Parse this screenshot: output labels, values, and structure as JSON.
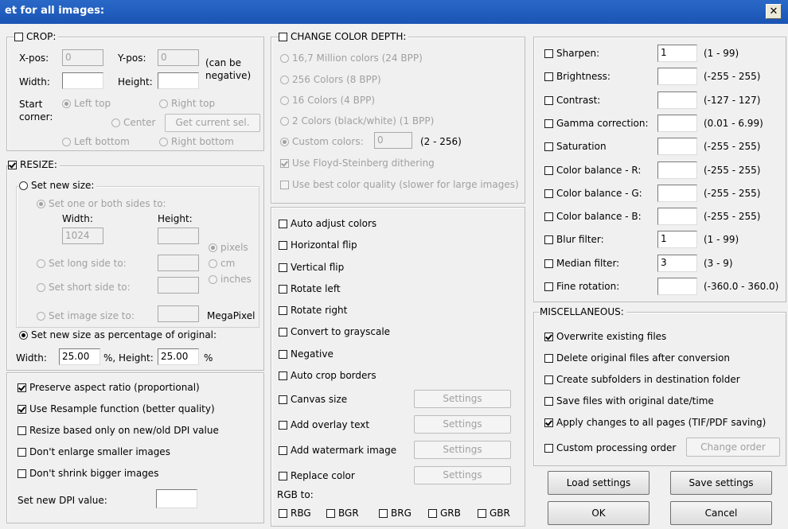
{
  "window": {
    "title": "et for all images:",
    "close_label": "✕"
  },
  "crop": {
    "legend": "CROP:",
    "xpos_label": "X-pos:",
    "xpos_value": "0",
    "ypos_label": "Y-pos:",
    "ypos_value": "0",
    "can_be_line1": "(can be",
    "can_be_line2": "negative)",
    "width_label": "Width:",
    "width_value": "",
    "height_label": "Height:",
    "height_value": "",
    "start_line1": "Start",
    "start_line2": "corner:",
    "left_top": "Left top",
    "right_top": "Right top",
    "center": "Center",
    "get_current_sel": "Get current sel.",
    "left_bottom": "Left bottom",
    "right_bottom": "Right bottom"
  },
  "resize": {
    "legend": "RESIZE:",
    "set_new_size": "Set new size:",
    "set_one_or_both": "Set one or both sides to:",
    "width_label": "Width:",
    "height_label": "Height:",
    "width_value": "1024",
    "height_value": "",
    "pixels": "pixels",
    "cm": "cm",
    "inches": "inches",
    "set_long_side": "Set long side to:",
    "long_side_value": "",
    "set_short_side": "Set short side to:",
    "short_side_value": "",
    "set_image_size": "Set image size to:",
    "image_size_value": "",
    "megapixel": "MegaPixel",
    "set_percentage": "Set new size as percentage of original:",
    "pct_width_label": "Width:",
    "pct_width_value": "25.00",
    "pct_height_label": "%, Height:",
    "pct_height_value": "25.00",
    "pct_symbol": "%",
    "preserve_aspect": "Preserve aspect ratio (proportional)",
    "use_resample": "Use Resample function (better quality)",
    "resize_dpi": "Resize based only on new/old DPI value",
    "dont_enlarge": "Don't enlarge smaller images",
    "dont_shrink": "Don't shrink bigger images",
    "set_dpi_label": "Set new DPI value:",
    "dpi_value": ""
  },
  "color_depth": {
    "legend": "CHANGE COLOR DEPTH:",
    "opt_24": "16,7 Million colors (24 BPP)",
    "opt_8": "256 Colors (8 BPP)",
    "opt_4": "16 Colors (4 BPP)",
    "opt_1": "2 Colors (black/white) (1 BPP)",
    "custom_label": "Custom colors:",
    "custom_value": "0",
    "custom_range": "(2 - 256)",
    "floyd": "Use Floyd-Steinberg dithering",
    "best_quality": "Use best color quality (slower for large images)"
  },
  "transforms": {
    "auto_adjust": "Auto adjust colors",
    "horizontal_flip": "Horizontal flip",
    "vertical_flip": "Vertical flip",
    "rotate_left": "Rotate left",
    "rotate_right": "Rotate right",
    "grayscale": "Convert to grayscale",
    "negative": "Negative",
    "auto_crop": "Auto crop borders",
    "canvas_size": "Canvas size",
    "add_overlay_text": "Add overlay text",
    "add_watermark": "Add watermark image",
    "replace_color": "Replace color",
    "settings": "Settings",
    "rgb_to": "RGB to:",
    "rbg": "RBG",
    "bgr": "BGR",
    "brg": "BRG",
    "grb": "GRB",
    "gbr": "GBR"
  },
  "adjustments": [
    {
      "label": "Sharpen:",
      "value": "1",
      "range": "(1  -  99)"
    },
    {
      "label": "Brightness:",
      "value": "",
      "range": "(-255  -  255)"
    },
    {
      "label": "Contrast:",
      "value": "",
      "range": "(-127  -  127)"
    },
    {
      "label": "Gamma correction:",
      "value": "",
      "range": "(0.01  -  6.99)"
    },
    {
      "label": "Saturation",
      "value": "",
      "range": "(-255  -  255)"
    },
    {
      "label": "Color balance - R:",
      "value": "",
      "range": "(-255  -  255)"
    },
    {
      "label": "Color balance - G:",
      "value": "",
      "range": "(-255  -  255)"
    },
    {
      "label": "Color balance - B:",
      "value": "",
      "range": "(-255  -  255)"
    },
    {
      "label": "Blur filter:",
      "value": "1",
      "range": "(1  -  99)"
    },
    {
      "label": "Median filter:",
      "value": "3",
      "range": "(3  -  9)"
    },
    {
      "label": "Fine rotation:",
      "value": "",
      "range": "(-360.0  -  360.0)"
    }
  ],
  "misc": {
    "legend": "MISCELLANEOUS:",
    "overwrite": "Overwrite existing files",
    "delete_original": "Delete original files after conversion",
    "create_subfolders": "Create subfolders in destination folder",
    "save_date": "Save files with original date/time",
    "apply_all_pages": "Apply changes to all pages (TIF/PDF saving)",
    "custom_order": "Custom processing order",
    "change_order": "Change order"
  },
  "buttons": {
    "load": "Load settings",
    "save": "Save settings",
    "ok": "OK",
    "cancel": "Cancel"
  },
  "colors": {
    "titlebar": "#1f5ec0",
    "dialog_bg": "#f0f0f0",
    "border_bg": "#bcd6ec"
  },
  "icons": {
    "close": "close-icon"
  }
}
